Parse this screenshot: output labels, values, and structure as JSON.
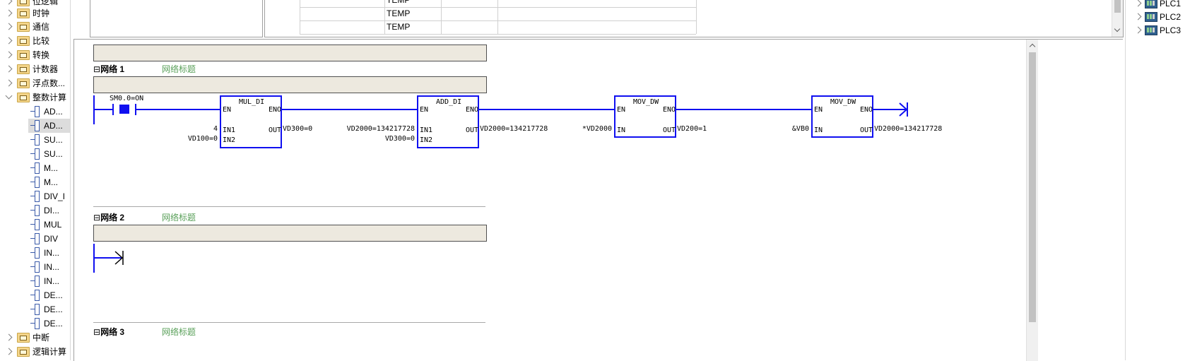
{
  "tree": {
    "folders": [
      {
        "label": "位逻辑"
      },
      {
        "label": "时钟"
      },
      {
        "label": "通信"
      },
      {
        "label": "比较"
      },
      {
        "label": "转换"
      },
      {
        "label": "计数器"
      },
      {
        "label": "浮点数..."
      },
      {
        "label": "整数计算"
      }
    ],
    "integer_items": [
      "AD...",
      "AD...",
      "SU...",
      "SU...",
      "M...",
      "M...",
      "DIV_I",
      "DI...",
      "MUL",
      "DIV",
      "IN...",
      "IN...",
      "IN...",
      "DE...",
      "DE...",
      "DE..."
    ],
    "bottom_folders": [
      {
        "label": "中断"
      },
      {
        "label": "逻辑计算"
      }
    ]
  },
  "var_table": {
    "rows": [
      "TEMP",
      "TEMP",
      "TEMP"
    ]
  },
  "networks": [
    {
      "title": "网络 1",
      "subtitle": "网络标题",
      "contact": "SM0.0=ON",
      "blocks": [
        {
          "name": "MUL_DI",
          "en": "EN",
          "eno": "ENO",
          "in1_label": "IN1",
          "in2_label": "IN2",
          "out_label": "OUT",
          "in1": "4",
          "in2": "VD100=0",
          "out": "VD300=0"
        },
        {
          "name": "ADD_DI",
          "en": "EN",
          "eno": "ENO",
          "in1_label": "IN1",
          "in2_label": "IN2",
          "out_label": "OUT",
          "in1": "VD2000=134217728",
          "in2": "VD300=0",
          "out": "VD2000=134217728"
        },
        {
          "name": "MOV_DW",
          "en": "EN",
          "eno": "ENO",
          "in_label": "IN",
          "out_label": "OUT",
          "in": "*VD2000",
          "out": "VD200=1"
        },
        {
          "name": "MOV_DW",
          "en": "EN",
          "eno": "ENO",
          "in_label": "IN",
          "out_label": "OUT",
          "in": "&VB0",
          "out": "VD2000=134217728"
        }
      ]
    },
    {
      "title": "网络 2",
      "subtitle": "网络标题"
    },
    {
      "title": "网络 3",
      "subtitle": "网络标题"
    }
  ],
  "project": {
    "items": [
      "PLC1",
      "PLC2",
      "PLC3"
    ]
  },
  "colors": {
    "ladder_blue": "#1010f0",
    "comment_bg": "#ede9df",
    "subtitle_green": "#5aa05a"
  }
}
